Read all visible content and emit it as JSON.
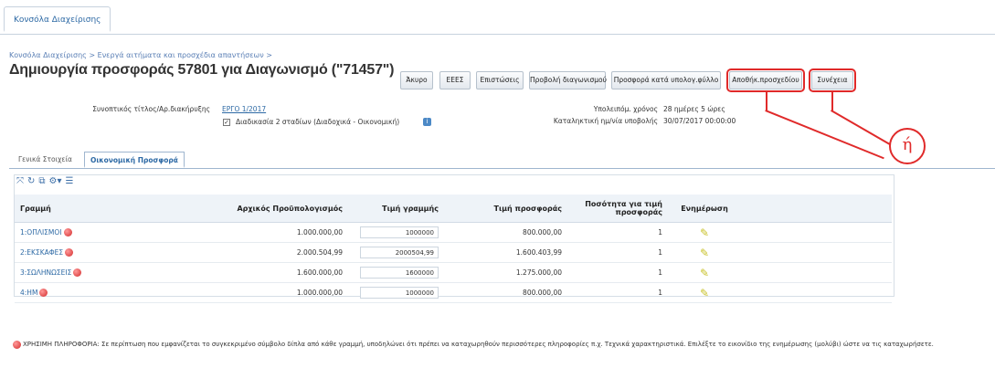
{
  "top_tab": "Κονσόλα Διαχείρισης",
  "breadcrumb": "Κονσόλα Διαχείρισης > Ενεργά αιτήματα και προσχέδια απαντήσεων >",
  "page_title": "Δημιουργία προσφοράς 57801 για Διαγωνισμό (\"71457\")",
  "buttons": {
    "cancel": "Άκυρο",
    "eeee": "ΕΕΕΣ",
    "checks": "Επιστώσεις",
    "view_tender": "Προβολή διαγωνισμού",
    "offer_spreadsheet": "Προσφορά κατά υπολογ.φύλλο",
    "save_draft": "Αποθήκ.προσχεδίου",
    "continue": "Συνέχεια"
  },
  "or_label": "ή",
  "info": {
    "contract_label": "Συνοπτικός τίτλος/Αρ.διακήρυξης",
    "contract_value": "ΕΡΓΟ 1/2017",
    "procedure_text": "Διαδικασία 2 σταδίων (Διαδοχικά - Οικονομική)",
    "remaining_label": "Υπολειπόμ. χρόνος",
    "remaining_value": "28 ημέρες 5 ώρες",
    "deadline_label": "Καταληκτική ημ/νία υποβολής",
    "deadline_value": "30/07/2017 00:00:00"
  },
  "subtabs": [
    "Γενικά Στοιχεία",
    "Οικονομική Προσφορά"
  ],
  "toolbar_icons": [
    "expand-icon",
    "refresh-icon",
    "detach-icon",
    "settings-icon",
    "menu-icon"
  ],
  "table": {
    "headers": [
      "Γραμμή",
      "Αρχικός Προϋπολογισμός",
      "Τιμή γραμμής",
      "Τιμή προσφοράς",
      "Ποσότητα για τιμή προσφοράς",
      "Ενημέρωση"
    ],
    "rows": [
      {
        "line": "1:ΟΠΛΙΣΜΟΙ",
        "budget": "1.000.000,00",
        "line_price": "1000000",
        "offer_price": "800.000,00",
        "qty": "1"
      },
      {
        "line": "2:ΕΚΣΚΑΦΕΣ",
        "budget": "2.000.504,99",
        "line_price": "2000504,99",
        "offer_price": "1.600.403,99",
        "qty": "1"
      },
      {
        "line": "3:ΣΩΛΗΝΩΣΕΙΣ",
        "budget": "1.600.000,00",
        "line_price": "1600000",
        "offer_price": "1.275.000,00",
        "qty": "1"
      },
      {
        "line": "4:ΗΜ",
        "budget": "1.000.000,00",
        "line_price": "1000000",
        "offer_price": "800.000,00",
        "qty": "1"
      }
    ]
  },
  "footnote": "ΧΡΗΣΙΜΗ ΠΛΗΡΟΦΟΡΙΑ: Σε περίπτωση που εμφανίζεται το συγκεκριμένο σύμβολο δίπλα από κάθε γραμμή, υποδηλώνει ότι πρέπει να καταχωρηθούν περισσότερες πληροφορίες π.χ. Τεχνικά χαρακτηριστικά. Επιλέξτε το εικονίδιο της ενημέρωσης (μολύβι) ώστε να τις καταχωρήσετε.",
  "colors": {
    "accent": "#2e6aa5",
    "highlight": "#e02a2a"
  }
}
